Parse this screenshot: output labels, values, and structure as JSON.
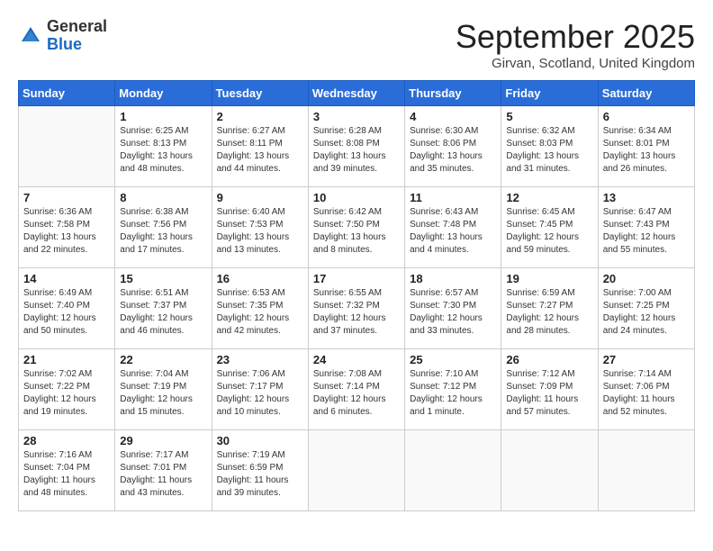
{
  "header": {
    "logo_general": "General",
    "logo_blue": "Blue",
    "month_title": "September 2025",
    "location": "Girvan, Scotland, United Kingdom"
  },
  "weekdays": [
    "Sunday",
    "Monday",
    "Tuesday",
    "Wednesday",
    "Thursday",
    "Friday",
    "Saturday"
  ],
  "weeks": [
    [
      {
        "day": "",
        "info": ""
      },
      {
        "day": "1",
        "info": "Sunrise: 6:25 AM\nSunset: 8:13 PM\nDaylight: 13 hours\nand 48 minutes."
      },
      {
        "day": "2",
        "info": "Sunrise: 6:27 AM\nSunset: 8:11 PM\nDaylight: 13 hours\nand 44 minutes."
      },
      {
        "day": "3",
        "info": "Sunrise: 6:28 AM\nSunset: 8:08 PM\nDaylight: 13 hours\nand 39 minutes."
      },
      {
        "day": "4",
        "info": "Sunrise: 6:30 AM\nSunset: 8:06 PM\nDaylight: 13 hours\nand 35 minutes."
      },
      {
        "day": "5",
        "info": "Sunrise: 6:32 AM\nSunset: 8:03 PM\nDaylight: 13 hours\nand 31 minutes."
      },
      {
        "day": "6",
        "info": "Sunrise: 6:34 AM\nSunset: 8:01 PM\nDaylight: 13 hours\nand 26 minutes."
      }
    ],
    [
      {
        "day": "7",
        "info": "Sunrise: 6:36 AM\nSunset: 7:58 PM\nDaylight: 13 hours\nand 22 minutes."
      },
      {
        "day": "8",
        "info": "Sunrise: 6:38 AM\nSunset: 7:56 PM\nDaylight: 13 hours\nand 17 minutes."
      },
      {
        "day": "9",
        "info": "Sunrise: 6:40 AM\nSunset: 7:53 PM\nDaylight: 13 hours\nand 13 minutes."
      },
      {
        "day": "10",
        "info": "Sunrise: 6:42 AM\nSunset: 7:50 PM\nDaylight: 13 hours\nand 8 minutes."
      },
      {
        "day": "11",
        "info": "Sunrise: 6:43 AM\nSunset: 7:48 PM\nDaylight: 13 hours\nand 4 minutes."
      },
      {
        "day": "12",
        "info": "Sunrise: 6:45 AM\nSunset: 7:45 PM\nDaylight: 12 hours\nand 59 minutes."
      },
      {
        "day": "13",
        "info": "Sunrise: 6:47 AM\nSunset: 7:43 PM\nDaylight: 12 hours\nand 55 minutes."
      }
    ],
    [
      {
        "day": "14",
        "info": "Sunrise: 6:49 AM\nSunset: 7:40 PM\nDaylight: 12 hours\nand 50 minutes."
      },
      {
        "day": "15",
        "info": "Sunrise: 6:51 AM\nSunset: 7:37 PM\nDaylight: 12 hours\nand 46 minutes."
      },
      {
        "day": "16",
        "info": "Sunrise: 6:53 AM\nSunset: 7:35 PM\nDaylight: 12 hours\nand 42 minutes."
      },
      {
        "day": "17",
        "info": "Sunrise: 6:55 AM\nSunset: 7:32 PM\nDaylight: 12 hours\nand 37 minutes."
      },
      {
        "day": "18",
        "info": "Sunrise: 6:57 AM\nSunset: 7:30 PM\nDaylight: 12 hours\nand 33 minutes."
      },
      {
        "day": "19",
        "info": "Sunrise: 6:59 AM\nSunset: 7:27 PM\nDaylight: 12 hours\nand 28 minutes."
      },
      {
        "day": "20",
        "info": "Sunrise: 7:00 AM\nSunset: 7:25 PM\nDaylight: 12 hours\nand 24 minutes."
      }
    ],
    [
      {
        "day": "21",
        "info": "Sunrise: 7:02 AM\nSunset: 7:22 PM\nDaylight: 12 hours\nand 19 minutes."
      },
      {
        "day": "22",
        "info": "Sunrise: 7:04 AM\nSunset: 7:19 PM\nDaylight: 12 hours\nand 15 minutes."
      },
      {
        "day": "23",
        "info": "Sunrise: 7:06 AM\nSunset: 7:17 PM\nDaylight: 12 hours\nand 10 minutes."
      },
      {
        "day": "24",
        "info": "Sunrise: 7:08 AM\nSunset: 7:14 PM\nDaylight: 12 hours\nand 6 minutes."
      },
      {
        "day": "25",
        "info": "Sunrise: 7:10 AM\nSunset: 7:12 PM\nDaylight: 12 hours\nand 1 minute."
      },
      {
        "day": "26",
        "info": "Sunrise: 7:12 AM\nSunset: 7:09 PM\nDaylight: 11 hours\nand 57 minutes."
      },
      {
        "day": "27",
        "info": "Sunrise: 7:14 AM\nSunset: 7:06 PM\nDaylight: 11 hours\nand 52 minutes."
      }
    ],
    [
      {
        "day": "28",
        "info": "Sunrise: 7:16 AM\nSunset: 7:04 PM\nDaylight: 11 hours\nand 48 minutes."
      },
      {
        "day": "29",
        "info": "Sunrise: 7:17 AM\nSunset: 7:01 PM\nDaylight: 11 hours\nand 43 minutes."
      },
      {
        "day": "30",
        "info": "Sunrise: 7:19 AM\nSunset: 6:59 PM\nDaylight: 11 hours\nand 39 minutes."
      },
      {
        "day": "",
        "info": ""
      },
      {
        "day": "",
        "info": ""
      },
      {
        "day": "",
        "info": ""
      },
      {
        "day": "",
        "info": ""
      }
    ]
  ]
}
